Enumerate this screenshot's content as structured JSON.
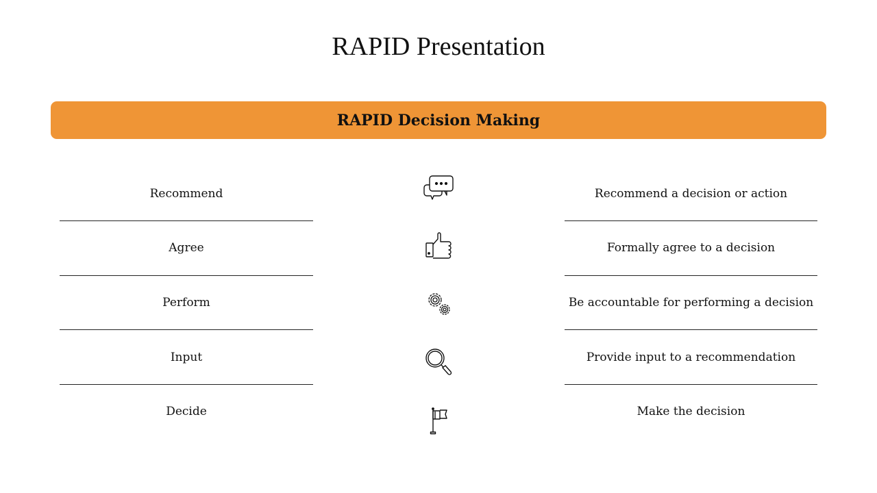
{
  "slide": {
    "title": "RAPID Presentation",
    "banner": {
      "label": "RAPID Decision Making",
      "color": "#ef9536"
    }
  },
  "rows": [
    {
      "role": "Recommend",
      "description": "Recommend a decision or action",
      "icon": "speech-bubbles-icon"
    },
    {
      "role": "Agree",
      "description": "Formally agree to a decision",
      "icon": "thumbs-up-icon"
    },
    {
      "role": "Perform",
      "description": "Be accountable for performing a decision",
      "icon": "gears-icon"
    },
    {
      "role": "Input",
      "description": "Provide input to a recommendation",
      "icon": "magnifier-icon"
    },
    {
      "role": "Decide",
      "description": "Make the decision",
      "icon": "flag-icon"
    }
  ]
}
